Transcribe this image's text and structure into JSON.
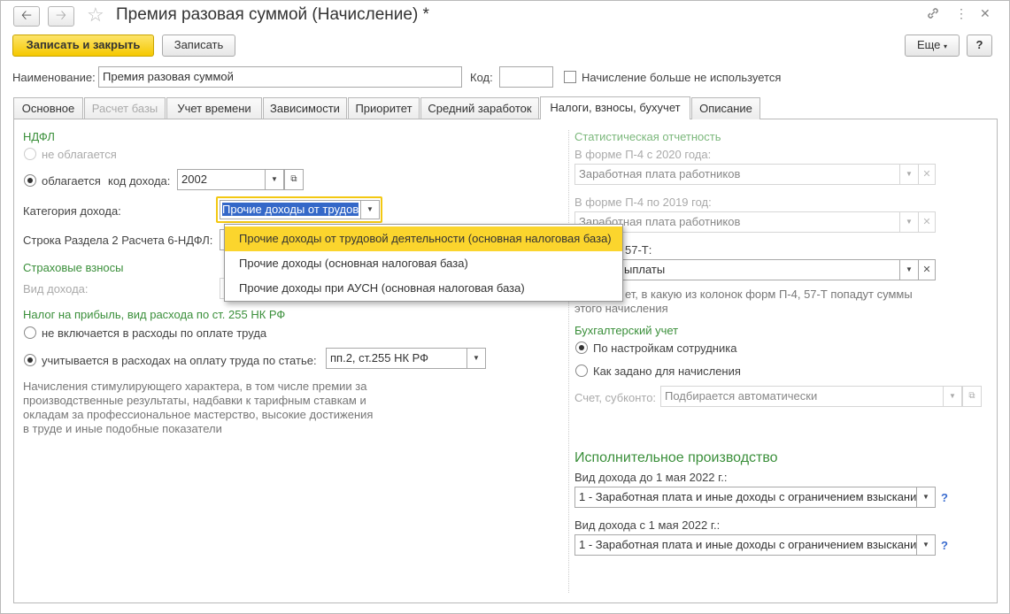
{
  "window": {
    "title": "Премия разовая суммой (Начисление) *",
    "back_icon": "arrow-left",
    "forward_icon": "arrow-right",
    "star_icon": "star"
  },
  "toolbar": {
    "save_close": "Записать и закрыть",
    "save": "Записать",
    "more": "Еще",
    "help": "?"
  },
  "header": {
    "name_label": "Наименование:",
    "name_value": "Премия разовая суммой",
    "code_label": "Код:",
    "code_value": "",
    "unused_label": "Начисление больше не используется"
  },
  "tabs": [
    {
      "label": "Основное"
    },
    {
      "label": "Расчет базы"
    },
    {
      "label": "Учет времени"
    },
    {
      "label": "Зависимости"
    },
    {
      "label": "Приоритет"
    },
    {
      "label": "Средний заработок"
    },
    {
      "label": "Налоги, взносы, бухучет"
    },
    {
      "label": "Описание"
    }
  ],
  "left": {
    "ndfl_title": "НДФЛ",
    "not_taxed": "не облагается",
    "taxed": "облагается",
    "income_code_label": "код дохода:",
    "income_code": "2002",
    "category_label": "Категория дохода:",
    "category_value": "Прочие доходы от трудов",
    "row_label": "Строка Раздела 2 Расчета 6-НДФЛ:",
    "insurance_title": "Страховые взносы",
    "income_type_label": "Вид дохода:",
    "profit_title": "Налог на прибыль, вид расхода по ст. 255 НК РФ",
    "not_included": "не включается в расходы по оплате труда",
    "included": "учитывается в расходах на оплату труда по статье:",
    "article_value": "пп.2, ст.255 НК РФ",
    "note": [
      "Начисления стимулирующего характера, в том числе премии за",
      "производственные результаты, надбавки к тарифным ставкам и",
      "окладам за профессиональное мастерство, высокие достижения",
      "в труде и иные подобные показатели"
    ]
  },
  "popup": {
    "items": [
      "Прочие доходы от трудовой деятельности (основная налоговая база)",
      "Прочие доходы (основная налоговая база)",
      "Прочие доходы при АУСН (основная налоговая база)"
    ]
  },
  "right": {
    "stat_title": "Статистическая отчетность",
    "p4_2020_label": "В форме П-4 с 2020 года:",
    "p4_2020_value": "Заработная плата работников",
    "p4_2019_label": "В форме П-4 по 2019 год:",
    "p4_2019_value": "Заработная плата работников",
    "f57_label": "57-Т:",
    "f57_value": "ыплаты",
    "stat_note": [
      "ет, в какую из колонок форм П-4, 57-Т попадут суммы",
      "этого начисления"
    ],
    "acc_title": "Бухгалтерский учет",
    "by_employee": "По настройкам сотрудника",
    "as_set": "Как задано для начисления",
    "account_label": "Счет, субконто:",
    "account_value": "Подбирается автоматически",
    "exec_title": "Исполнительное производство",
    "before_label": "Вид дохода до 1 мая 2022 г.:",
    "before_value": "1 - Заработная плата и иные доходы с ограничением взыскания",
    "after_label": "Вид дохода с 1 мая 2022 г.:",
    "after_value": "1 - Заработная плата и иные доходы с ограничением взыскания",
    "q": "?"
  }
}
